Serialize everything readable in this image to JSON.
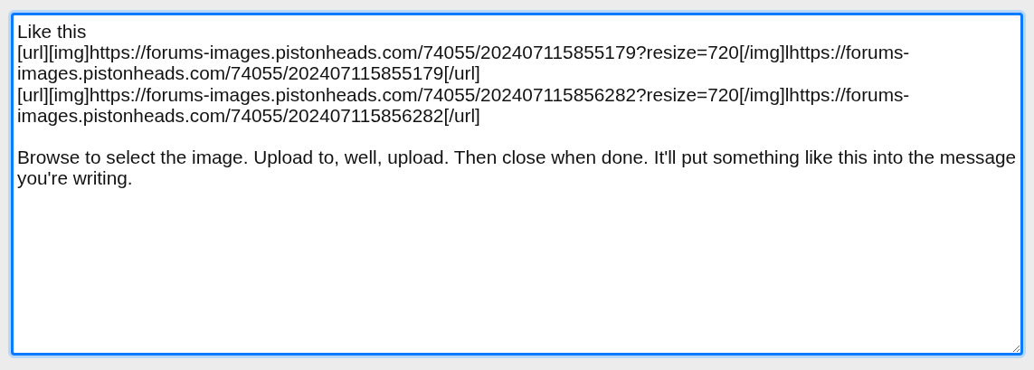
{
  "message_field": {
    "focused": true,
    "paragraphs": [
      {
        "lines": [
          "Like this",
          "[url][img]https://forums-images.pistonheads.com/74055/202407115855179?resize=720[/img]lhttps://forums-images.pistonheads.com/74055/202407115855179[/url]",
          "[url][img]https://forums-images.pistonheads.com/74055/202407115856282?resize=720[/img]lhttps://forums-images.pistonheads.com/74055/202407115856282[/url]"
        ]
      },
      {
        "lines": [
          "Browse to select the image. Upload to, well, upload. Then close when done. It'll put something like this into the message you're writing."
        ]
      }
    ]
  }
}
